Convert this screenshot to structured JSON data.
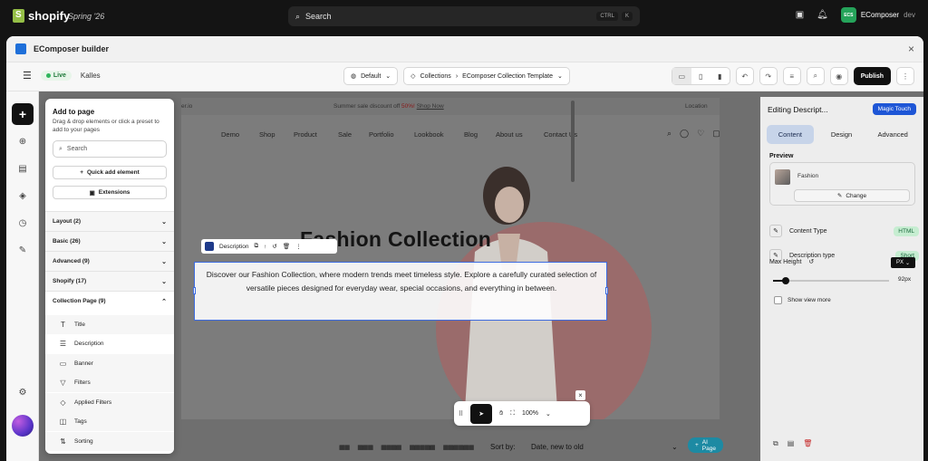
{
  "shopify": {
    "logo_text": "shopify",
    "edition": "Spring '26",
    "search_placeholder": "Search",
    "shortcut_keys": [
      "CTRL",
      "K"
    ],
    "store_initials": "ECS",
    "store_name": "EComposer",
    "store_env": "dev"
  },
  "window": {
    "title": "EComposer builder",
    "close_icon": "×"
  },
  "toolbar": {
    "live_label": "Live",
    "theme_name": "Kalles",
    "variant_dropdown": "Default",
    "breadcrumb_parent": "Collections",
    "breadcrumb_separator": "›",
    "template_name": "EComposer Collection Template",
    "publish_label": "Publish"
  },
  "add_panel": {
    "title": "Add to page",
    "description": "Drag & drop elements or click a preset to add to your pages",
    "search_placeholder": "Search",
    "quick_add_label": "Quick add element",
    "extensions_label": "Extensions",
    "sections": [
      {
        "label": "Layout (2)"
      },
      {
        "label": "Basic (26)"
      },
      {
        "label": "Advanced (9)"
      },
      {
        "label": "Shopify (17)"
      },
      {
        "label": "Collection Page (9)"
      }
    ],
    "items": [
      {
        "label": "Title",
        "icon": "title-icon"
      },
      {
        "label": "Description",
        "icon": "description-icon"
      },
      {
        "label": "Banner",
        "icon": "banner-icon"
      },
      {
        "label": "Filters",
        "icon": "filter-icon"
      },
      {
        "label": "Applied Filters",
        "icon": "applied-filters-icon"
      },
      {
        "label": "Tags",
        "icon": "tag-icon"
      },
      {
        "label": "Sorting",
        "icon": "sorting-icon"
      }
    ]
  },
  "canvas": {
    "announce_brand": "er.io",
    "announce_text": "Summer sale discount off",
    "announce_pct": "50%!",
    "announce_link": "Shop Now",
    "location_label": "Location",
    "nav": [
      "Demo",
      "Shop",
      "Product",
      "Sale",
      "Portfolio",
      "Lookbook",
      "Blog",
      "About us",
      "Contact Us"
    ],
    "hero_title": "Fashion Collection",
    "element_label": "Description",
    "description_text": "Discover our Fashion Collection, where modern trends meet timeless style. Explore a carefully curated selection of versatile pieces designed for everyday wear, special occasions, and everything in between.",
    "sort_label": "Sort by:",
    "sort_value": "Date, new to old",
    "ai_page_label": "AI Page",
    "zoom": "100%"
  },
  "right_panel": {
    "title": "Editing Descript...",
    "magic_touch": "Magic Touch",
    "tabs": [
      "Content",
      "Design",
      "Advanced"
    ],
    "preview_label": "Preview",
    "preview_item": "Fashion",
    "change_label": "Change",
    "content_type_label": "Content Type",
    "content_type_value": "HTML",
    "description_type_label": "Description type",
    "description_type_value": "Short",
    "max_height_label": "Max Height",
    "unit": "PX",
    "max_height_value": "92px",
    "max_height_fraction": 0.11,
    "show_view_more_label": "Show view more"
  }
}
